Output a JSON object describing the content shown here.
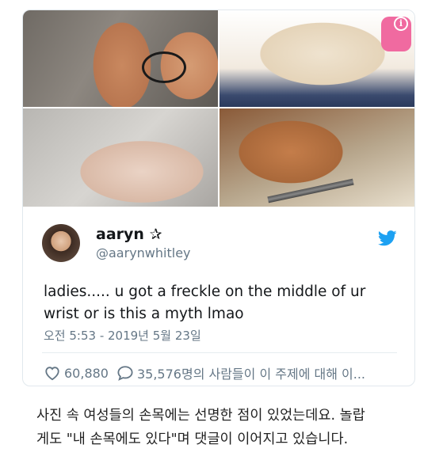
{
  "tweet": {
    "display_name": "aaryn",
    "name_symbol": "✰",
    "handle": "@aarynwhitley",
    "text": "ladies..... u got a freckle on the middle of ur wrist or is this a myth lmao",
    "timestamp": "오전 5:53 - 2019년 5월 23일",
    "likes": "60,880",
    "replies_text": "35,576명의 사람들이 이 주제에 대해 이..."
  },
  "article": {
    "caption_line1": "사진 속 여성들의 손목에는 선명한 점이 있었는데요. 놀랍",
    "caption_line2": "게도 \"내 손목에도 있다\"며 댓글이 이어지고 있습니다."
  },
  "icons": {
    "info": "info-icon",
    "bird": "twitter-bird-icon",
    "heart": "heart-icon",
    "reply": "reply-bubble-icon"
  },
  "colors": {
    "twitter_blue": "#1da1f2",
    "secondary_text": "#657786"
  }
}
